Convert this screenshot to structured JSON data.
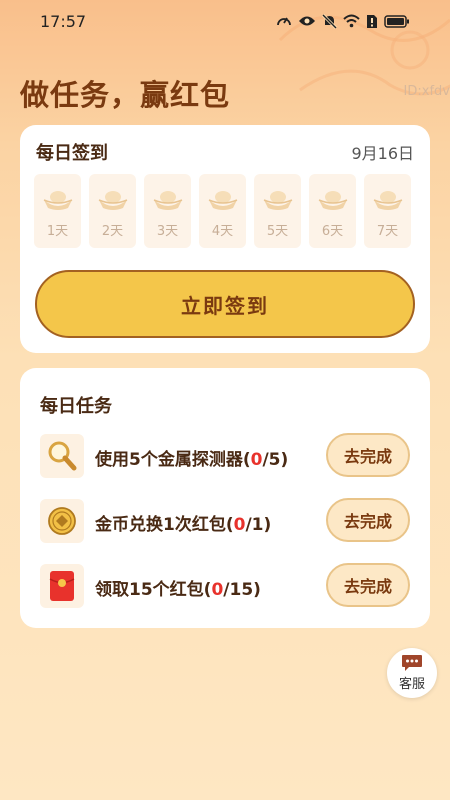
{
  "status_bar": {
    "time": "17:57",
    "battery_glyph": "battery-icon"
  },
  "page": {
    "title": "做任务，赢红包",
    "id_text": "ID:xfdv"
  },
  "signin": {
    "title": "每日签到",
    "date": "9月16日",
    "days": [
      "1天",
      "2天",
      "3天",
      "4天",
      "5天",
      "6天",
      "7天"
    ],
    "button_label": "立即签到"
  },
  "tasks": {
    "title": "每日任务",
    "items": [
      {
        "prefix": "使用5个金属探测器(",
        "done": "0",
        "suffix": "/5)",
        "button": "去完成",
        "icon": "magnifier-icon"
      },
      {
        "prefix": "金币兑换1次红包(",
        "done": "0",
        "suffix": "/1)",
        "button": "去完成",
        "icon": "coin-icon"
      },
      {
        "prefix": "领取15个红包(",
        "done": "0",
        "suffix": "/15)",
        "button": "去完成",
        "icon": "red-envelope-icon"
      }
    ]
  },
  "customer_service": {
    "label": "客服",
    "icon": "chat-bubble-icon"
  },
  "colors": {
    "accent": "#f4c64a",
    "title": "#7a3a10",
    "highlight": "#e8322c"
  }
}
